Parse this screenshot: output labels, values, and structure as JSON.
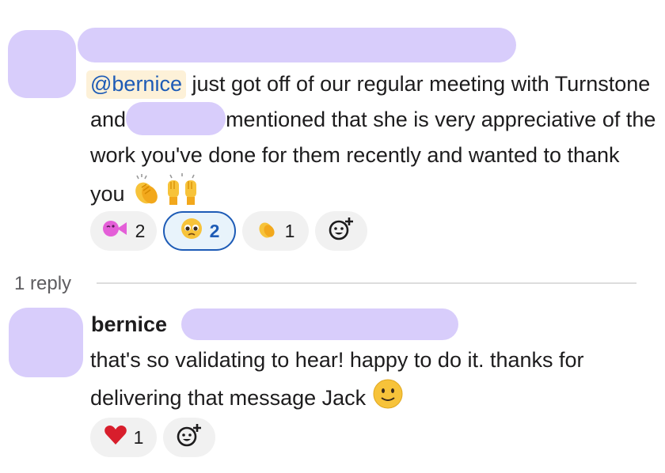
{
  "message1": {
    "mention": "@bernice",
    "text_a": " just got off of our regular meeting with Turnstone and",
    "text_b": "mentioned that she is very appreciative of the work you've done for them recently and wanted to thank you ",
    "emojis": [
      "clapping-hands",
      "raising-hands"
    ],
    "reactions": [
      {
        "icon": "pink-kiss-emoji",
        "count": "2",
        "active": false
      },
      {
        "icon": "pleading-face-emoji",
        "count": "2",
        "active": true
      },
      {
        "icon": "clapping-hands-emoji",
        "count": "1",
        "active": false
      }
    ]
  },
  "thread": {
    "reply_count": "1 reply"
  },
  "reply": {
    "author": "bernice",
    "text": "that's so validating to hear! happy to do it. thanks for delivering that message Jack ",
    "emoji": "slightly-smiling-face",
    "reactions": [
      {
        "icon": "red-heart-emoji",
        "count": "1",
        "active": false
      }
    ]
  },
  "colors": {
    "redaction": "#d8cdfb",
    "mention_bg": "#fdf1d8",
    "link_blue": "#1d5bb6",
    "pill_bg": "#f1f1f1"
  }
}
